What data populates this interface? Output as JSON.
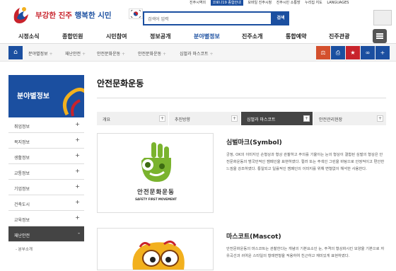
{
  "header": {
    "slogan_red": "부강한 진주",
    "slogan_blue": "행복한 시민",
    "search_placeholder": "검색어 입력",
    "search_button": "검색",
    "top_links": [
      "진주시역의",
      "코로나19 종합안내",
      "모바일 진주시청",
      "진주시민 소통방",
      "누리집 지도",
      "LANGUAGES"
    ],
    "brand_color": "#1b4fa0",
    "accent_color": "#c8232c"
  },
  "gnb": [
    "시정소식",
    "종합민원",
    "시민참여",
    "정보공개",
    "분야별정보",
    "진주소개",
    "통합예약",
    "진주관광"
  ],
  "gnb_active": "분야별정보",
  "breadcrumb": [
    "분야별정보",
    "재난안전",
    "안전문화운동",
    "안전문화운동",
    "심벌과 마스코트"
  ],
  "tools": [
    "share-icon",
    "print-icon",
    "link-icon",
    "bookmark-icon",
    "plus-icon"
  ],
  "snb": {
    "title": "분야별정보",
    "items": [
      {
        "label": "취업정보",
        "pm": "+"
      },
      {
        "label": "복지정보",
        "pm": "+"
      },
      {
        "label": "생활정보",
        "pm": "+"
      },
      {
        "label": "교통정보",
        "pm": "+"
      },
      {
        "label": "기업정보",
        "pm": "+"
      },
      {
        "label": "건축도시",
        "pm": "+"
      },
      {
        "label": "교육정보",
        "pm": "+"
      },
      {
        "label": "재난안전",
        "pm": "-"
      }
    ],
    "sub": "- 분부소개"
  },
  "content": {
    "title": "안전문화운동",
    "tabs": [
      {
        "label": "개요",
        "mark": "+"
      },
      {
        "label": "추진방향",
        "mark": "+"
      },
      {
        "label": "심벌과 마스코트",
        "mark": "+"
      },
      {
        "label": "안전관리현장",
        "mark": "+"
      }
    ],
    "symbol_caption": "안전문화운동",
    "symbol_subcaption": "SAFETY FIRST MOVEMENT",
    "symbol_title": "심벌마크(Symbol)",
    "symbol_text": "긍정, OK의 이미지인 손형상과 형상 관찰하고 주의를 기울이는 눈의 형상이 결합된 심벌의 형상은 안전문화운동의 범국민적인 캠페인을 표현하였다. 컬러 또는 주색인 그린을 바탕으로 안정적이고 편안한 느낌을 강조하였다. 통일되고 일률적인 캠페인의 이미지를 위해 변형없이 해석한 사용한다.",
    "mascot_title": "마스코트(Mascot)",
    "mascot_text": "안전문화운동의 마스코트는 관찰한다는 개념의 기본요소인 눈, 주격의 형상화시킨 모양을 기본으로 자유곡선과 귀여운 스타일의 형태변형을 적용하여 친근하고 재미있게 표현하였다."
  }
}
